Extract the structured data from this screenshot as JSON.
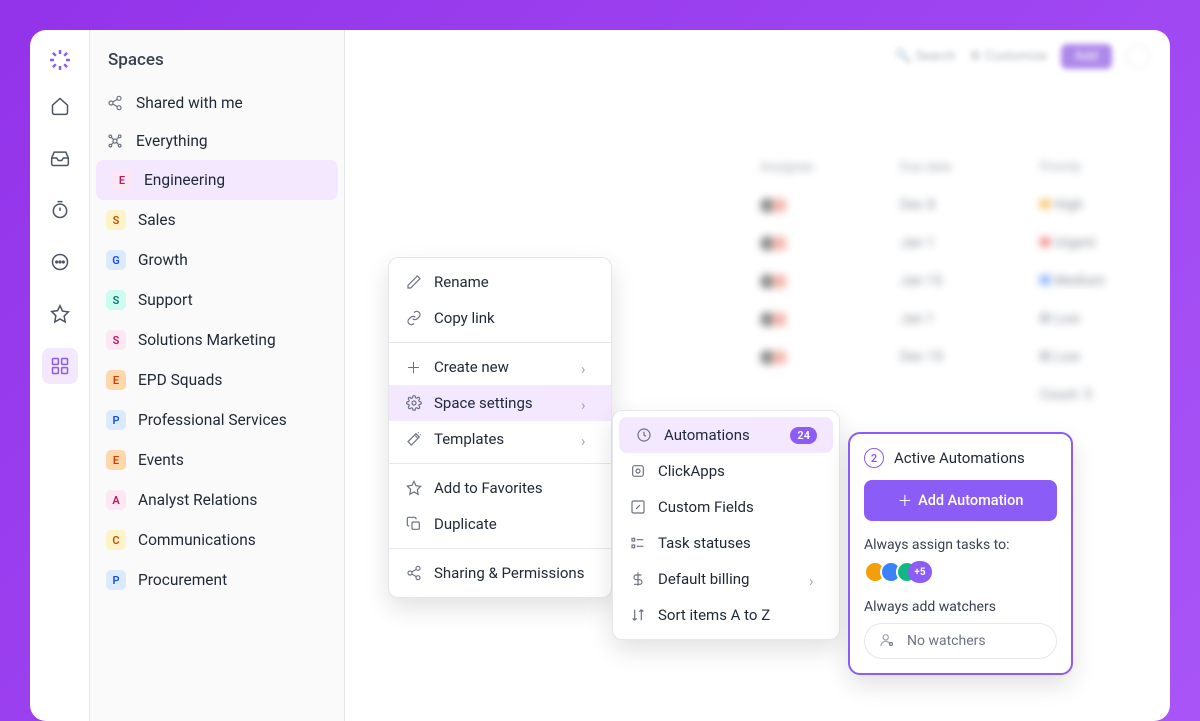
{
  "sidebar": {
    "title": "Spaces",
    "shared_label": "Shared with me",
    "everything_label": "Everything",
    "items": [
      {
        "badge": "E",
        "label": "Engineering",
        "bg": "#fce7f3",
        "fg": "#be185d",
        "active": true
      },
      {
        "badge": "S",
        "label": "Sales",
        "bg": "#fef3c7",
        "fg": "#b45309"
      },
      {
        "badge": "G",
        "label": "Growth",
        "bg": "#dbeafe",
        "fg": "#1d4ed8"
      },
      {
        "badge": "S",
        "label": "Support",
        "bg": "#ccfbf1",
        "fg": "#0f766e"
      },
      {
        "badge": "S",
        "label": "Solutions Marketing",
        "bg": "#fce7f3",
        "fg": "#be185d"
      },
      {
        "badge": "E",
        "label": "EPD Squads",
        "bg": "#fed7aa",
        "fg": "#c2410c"
      },
      {
        "badge": "P",
        "label": "Professional Services",
        "bg": "#dbeafe",
        "fg": "#1d4ed8"
      },
      {
        "badge": "E",
        "label": "Events",
        "bg": "#fed7aa",
        "fg": "#c2410c"
      },
      {
        "badge": "A",
        "label": "Analyst Relations",
        "bg": "#fce7f3",
        "fg": "#be185d"
      },
      {
        "badge": "C",
        "label": "Communications",
        "bg": "#fef3c7",
        "fg": "#b45309"
      },
      {
        "badge": "P",
        "label": "Procurement",
        "bg": "#dbeafe",
        "fg": "#1d4ed8"
      }
    ]
  },
  "top": {
    "search": "Search",
    "customize": "Customize",
    "add": "Add"
  },
  "blur_table": {
    "headers": [
      "Assignee",
      "Due date",
      "Priority"
    ],
    "rows": [
      {
        "date": "Dec 8",
        "priority": "High",
        "color": "#f59e0b"
      },
      {
        "date": "Jan 1",
        "priority": "Urgent",
        "color": "#ef4444"
      },
      {
        "date": "Jan 15",
        "priority": "Medium",
        "color": "#3b82f6"
      },
      {
        "date": "Jan 1",
        "priority": "Low",
        "color": "#9ca3af"
      },
      {
        "date": "Dec 15",
        "priority": "Low",
        "color": "#9ca3af"
      }
    ],
    "footer": "Count: 5"
  },
  "menu1": {
    "rename": "Rename",
    "copy_link": "Copy link",
    "create_new": "Create new",
    "space_settings": "Space settings",
    "templates": "Templates",
    "add_favorites": "Add to Favorites",
    "duplicate": "Duplicate",
    "sharing": "Sharing & Permissions"
  },
  "menu2": {
    "automations": "Automations",
    "automations_count": "24",
    "clickapps": "ClickApps",
    "custom_fields": "Custom Fields",
    "task_statuses": "Task statuses",
    "default_billing": "Default billing",
    "sort": "Sort items A to Z"
  },
  "popover": {
    "count": "2",
    "title": "Active Automations",
    "add_btn": "Add Automation",
    "assign_label": "Always assign tasks to:",
    "more_count": "+5",
    "watchers_label": "Always add watchers",
    "no_watchers": "No watchers"
  },
  "avatar_colors": [
    "#f59e0b",
    "#3b82f6",
    "#10b981"
  ]
}
